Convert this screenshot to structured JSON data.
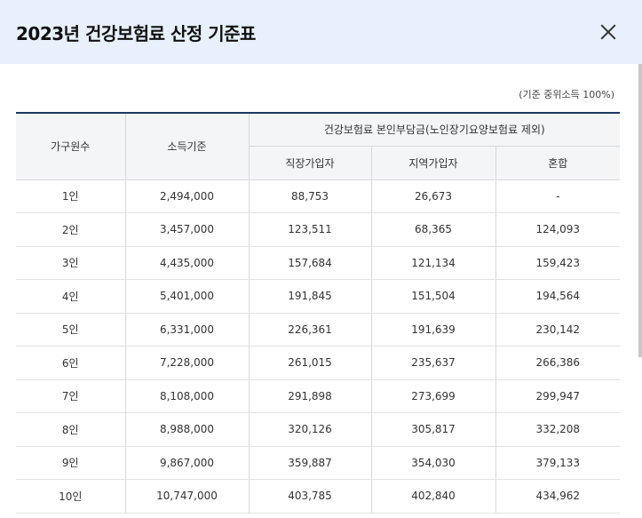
{
  "modal": {
    "title": "2023년 건강보험료 산정 기준표",
    "note": "(기준 중위소득 100%)"
  },
  "table": {
    "headers": {
      "household": "가구원수",
      "income": "소득기준",
      "premium_group": "건강보험료 본인부담금(노인장기요양보험료 제외)",
      "employee": "직장가입자",
      "regional": "지역가입자",
      "mixed": "혼합"
    },
    "rows": [
      [
        "1인",
        "2,494,000",
        "88,753",
        "26,673",
        "-"
      ],
      [
        "2인",
        "3,457,000",
        "123,511",
        "68,365",
        "124,093"
      ],
      [
        "3인",
        "4,435,000",
        "157,684",
        "121,134",
        "159,423"
      ],
      [
        "4인",
        "5,401,000",
        "191,845",
        "151,504",
        "194,564"
      ],
      [
        "5인",
        "6,331,000",
        "226,361",
        "191,639",
        "230,142"
      ],
      [
        "6인",
        "7,228,000",
        "261,015",
        "235,637",
        "266,386"
      ],
      [
        "7인",
        "8,108,000",
        "291,898",
        "273,699",
        "299,947"
      ],
      [
        "8인",
        "8,988,000",
        "320,126",
        "305,817",
        "332,208"
      ],
      [
        "9인",
        "9,867,000",
        "359,887",
        "354,030",
        "379,133"
      ],
      [
        "10인",
        "10,747,000",
        "403,785",
        "402,840",
        "434,962"
      ]
    ]
  }
}
